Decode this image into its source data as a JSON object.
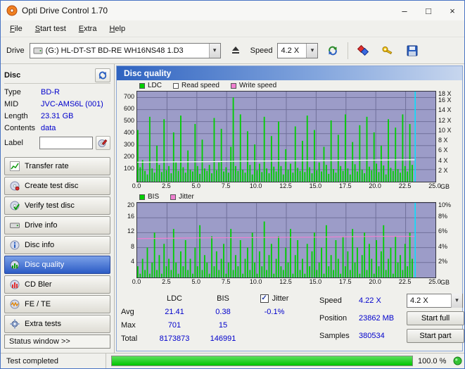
{
  "window": {
    "title": "Opti Drive Control 1.70"
  },
  "icons": {
    "minimize": "–",
    "maximize": "□",
    "close": "×",
    "dropdown": "▾",
    "check": "✓"
  },
  "menu": {
    "items": [
      "File",
      "Start test",
      "Extra",
      "Help"
    ]
  },
  "toolbar": {
    "drive_label": "Drive",
    "drive_value": "(G:)  HL-DT-ST BD-RE  WH16NS48 1.D3",
    "speed_label": "Speed",
    "speed_value": "4.2 X"
  },
  "sidebar": {
    "disc_header": "Disc",
    "info": [
      {
        "label": "Type",
        "value": "BD-R"
      },
      {
        "label": "MID",
        "value": "JVC-AMS6L (001)"
      },
      {
        "label": "Length",
        "value": "23.31 GB"
      },
      {
        "label": "Contents",
        "value": "data"
      }
    ],
    "label_label": "Label",
    "label_value": "",
    "buttons": [
      "Transfer rate",
      "Create test disc",
      "Verify test disc",
      "Drive info",
      "Disc info",
      "Disc quality",
      "CD Bler",
      "FE / TE",
      "Extra tests"
    ],
    "active_button": "Disc quality",
    "status_window": "Status window >>"
  },
  "panel": {
    "title": "Disc quality",
    "legend1": [
      {
        "label": "LDC",
        "color": "#00cf00"
      },
      {
        "label": "Read speed",
        "color": "#ffffff"
      },
      {
        "label": "Write speed",
        "color": "#f080d0"
      }
    ],
    "legend2": [
      {
        "label": "BIS",
        "color": "#00cf00"
      },
      {
        "label": "Jitter",
        "color": "#f080d0"
      }
    ]
  },
  "chart_data": [
    {
      "type": "bar",
      "title": "LDC errors vs position with read speed",
      "x_unit": "GB",
      "x_max": 25,
      "bar_step_x": 0.2,
      "bar_color": "#00cf00",
      "plot_bg": "#9c9cc8",
      "grid_color": "#70709a",
      "left_axis": {
        "max": 750,
        "ticks": [
          {
            "v": 700,
            "t": "700"
          },
          {
            "v": 600,
            "t": "600"
          },
          {
            "v": 500,
            "t": "500"
          },
          {
            "v": 400,
            "t": "400"
          },
          {
            "v": 300,
            "t": "300"
          },
          {
            "v": 200,
            "t": "200"
          },
          {
            "v": 100,
            "t": "100"
          }
        ]
      },
      "right_axis": {
        "max": 18,
        "ticks": [
          {
            "v": 18,
            "t": "18 X"
          },
          {
            "v": 16,
            "t": "16 X"
          },
          {
            "v": 14,
            "t": "14 X"
          },
          {
            "v": 12,
            "t": "12 X"
          },
          {
            "v": 10,
            "t": "10 X"
          },
          {
            "v": 8,
            "t": "8 X"
          },
          {
            "v": 6,
            "t": "6 X"
          },
          {
            "v": 4,
            "t": "4 X"
          },
          {
            "v": 2,
            "t": "2 X"
          }
        ]
      },
      "x_ticks": [
        {
          "v": 0,
          "t": "0.0"
        },
        {
          "v": 2.5,
          "t": "2.5"
        },
        {
          "v": 5,
          "t": "5.0"
        },
        {
          "v": 7.5,
          "t": "7.5"
        },
        {
          "v": 10,
          "t": "10.0"
        },
        {
          "v": 12.5,
          "t": "12.5"
        },
        {
          "v": 15,
          "t": "15.0"
        },
        {
          "v": 17.5,
          "t": "17.5"
        },
        {
          "v": 20,
          "t": "20.0"
        },
        {
          "v": 22.5,
          "t": "22.5"
        },
        {
          "v": 25,
          "t": "25.0"
        }
      ],
      "bars": [
        430,
        120,
        180,
        90,
        60,
        540,
        110,
        75,
        300,
        140,
        80,
        520,
        95,
        130,
        70,
        410,
        160,
        90,
        550,
        120,
        75,
        260,
        100,
        85,
        480,
        130,
        65,
        350,
        110,
        90,
        140,
        70,
        530,
        95,
        160,
        440,
        85,
        120,
        75,
        290,
        701,
        130,
        90,
        560,
        100,
        75,
        420,
        140,
        60,
        310,
        95,
        150,
        80,
        540,
        110,
        70,
        380,
        125,
        85,
        500,
        130,
        60,
        270,
        100,
        150,
        75,
        460,
        115,
        90,
        340,
        80,
        550,
        120,
        70,
        430,
        95,
        160,
        85,
        290,
        140,
        65,
        510,
        105,
        75,
        390,
        130,
        90,
        560,
        110,
        60,
        330,
        145,
        85,
        470,
        100,
        70,
        540,
        125,
        95,
        410,
        150,
        80,
        300,
        135,
        60,
        520,
        115,
        90,
        450,
        105,
        75,
        560,
        130,
        85,
        480,
        140
      ],
      "line": {
        "name": "Read speed",
        "color": "#ffffff",
        "points": [
          [
            0,
            3.9
          ],
          [
            3,
            3.95
          ],
          [
            6,
            4.0
          ],
          [
            9,
            4.1
          ],
          [
            12,
            4.15
          ],
          [
            15,
            4.2
          ],
          [
            18,
            4.28
          ],
          [
            21,
            4.33
          ],
          [
            23.3,
            4.38
          ]
        ]
      },
      "marker": {
        "x": 23.3,
        "color": "#00e4ff"
      }
    },
    {
      "type": "bar",
      "title": "BIS errors vs position with jitter",
      "x_unit": "GB",
      "x_max": 25,
      "bar_step_x": 0.2,
      "bar_color": "#00cf00",
      "plot_bg": "#9c9cc8",
      "grid_color": "#70709a",
      "left_axis": {
        "max": 20,
        "ticks": [
          {
            "v": 20,
            "t": "20"
          },
          {
            "v": 16,
            "t": "16"
          },
          {
            "v": 12,
            "t": "12"
          },
          {
            "v": 8,
            "t": "8"
          },
          {
            "v": 4,
            "t": "4"
          }
        ]
      },
      "right_axis": {
        "max": 10,
        "ticks": [
          {
            "v": 10,
            "t": "10%"
          },
          {
            "v": 8,
            "t": "8%"
          },
          {
            "v": 6,
            "t": "6%"
          },
          {
            "v": 4,
            "t": "4%"
          },
          {
            "v": 2,
            "t": "2%"
          }
        ]
      },
      "x_ticks": [
        {
          "v": 0,
          "t": "0.0"
        },
        {
          "v": 2.5,
          "t": "2.5"
        },
        {
          "v": 5,
          "t": "5.0"
        },
        {
          "v": 7.5,
          "t": "7.5"
        },
        {
          "v": 10,
          "t": "10.0"
        },
        {
          "v": 12.5,
          "t": "12.5"
        },
        {
          "v": 15,
          "t": "15.0"
        },
        {
          "v": 17.5,
          "t": "17.5"
        },
        {
          "v": 20,
          "t": "20.0"
        },
        {
          "v": 22.5,
          "t": "22.5"
        },
        {
          "v": 25,
          "t": "25.0"
        }
      ],
      "bars": [
        3,
        1,
        5,
        2,
        8,
        1,
        4,
        12,
        2,
        6,
        1,
        9,
        3,
        5,
        2,
        13,
        4,
        1,
        7,
        3,
        10,
        2,
        5,
        1,
        8,
        3,
        14,
        2,
        6,
        4,
        1,
        11,
        3,
        7,
        2,
        5,
        9,
        1,
        4,
        13,
        2,
        6,
        3,
        10,
        1,
        5,
        8,
        2,
        12,
        4,
        1,
        7,
        3,
        15,
        2,
        6,
        9,
        1,
        5,
        11,
        3,
        2,
        8,
        4,
        13,
        1,
        6,
        10,
        2,
        5,
        1,
        9,
        3,
        7,
        12,
        2,
        4,
        8,
        1,
        14,
        3,
        6,
        2,
        10,
        5,
        1,
        11,
        3,
        7,
        2,
        13,
        4,
        8,
        1,
        6,
        12,
        2,
        9,
        5,
        1,
        10,
        3,
        7,
        14,
        2,
        5,
        8,
        1,
        11,
        4,
        6,
        2,
        9,
        3,
        12,
        5
      ],
      "line": {
        "name": "Jitter",
        "color": "#f080d0",
        "points": [
          [
            0,
            5.2
          ],
          [
            5,
            5.3
          ],
          [
            10,
            5.35
          ],
          [
            15,
            5.4
          ],
          [
            20,
            5.5
          ],
          [
            23.3,
            5.5
          ]
        ]
      },
      "marker": {
        "x": 23.3,
        "color": "#00e4ff"
      }
    }
  ],
  "results": {
    "col_headers": [
      "LDC",
      "BIS"
    ],
    "jitter_label": "Jitter",
    "jitter_checked": true,
    "rows": [
      {
        "label": "Avg",
        "ldc": "21.41",
        "bis": "0.38",
        "jitter": "-0.1%"
      },
      {
        "label": "Max",
        "ldc": "701",
        "bis": "15",
        "jitter": ""
      },
      {
        "label": "Total",
        "ldc": "8173873",
        "bis": "146991",
        "jitter": ""
      }
    ],
    "speed_label": "Speed",
    "speed_value": "4.22 X",
    "speed_select": "4.2 X",
    "position_label": "Position",
    "position_value": "23862 MB",
    "samples_label": "Samples",
    "samples_value": "380534",
    "start_full": "Start full",
    "start_part": "Start part"
  },
  "statusbar": {
    "text": "Test completed",
    "percent": "100.0 %",
    "progress": 100
  }
}
